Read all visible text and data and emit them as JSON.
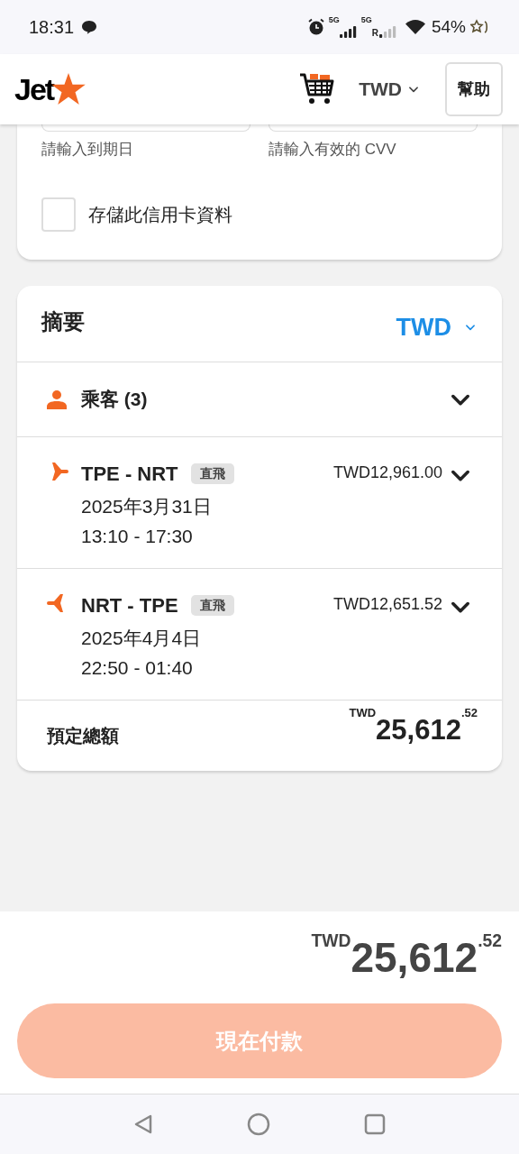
{
  "status_bar": {
    "time": "18:31",
    "signal_labels": [
      {
        "network": "5G"
      },
      {
        "network": "5G",
        "roaming": "R"
      }
    ],
    "battery": "54%"
  },
  "header": {
    "logo_text": "Jet",
    "currency": "TWD",
    "help": "幫助"
  },
  "card_form": {
    "fields": [
      {
        "error": "請輸入到期日"
      },
      {
        "error": "請輸入有效的 CVV"
      }
    ],
    "save_card": {
      "label": "存儲此信用卡資料",
      "checked": false
    }
  },
  "summary": {
    "title": "摘要",
    "currency": "TWD",
    "passengers": {
      "label": "乘客 (3)",
      "expanded": false
    },
    "flights": [
      {
        "kind": "outbound",
        "route": "TPE - NRT",
        "badge": "直飛",
        "date": "2025年3月31日",
        "time": "13:10 - 17:30",
        "price": "TWD12,961.00",
        "expanded": false
      },
      {
        "kind": "return",
        "route": "NRT - TPE",
        "badge": "直飛",
        "date": "2025年4月4日",
        "time": "22:50 - 01:40",
        "price": "TWD12,651.52",
        "expanded": false
      }
    ],
    "total_label": "預定總額",
    "total": "$^{TWD}$25,612$^{.52}$"
  },
  "footer": {
    "total": "$^{TWD}$25,612$^{.52}$",
    "pay_button": {
      "label": "現在付款",
      "disabled": true
    }
  }
}
